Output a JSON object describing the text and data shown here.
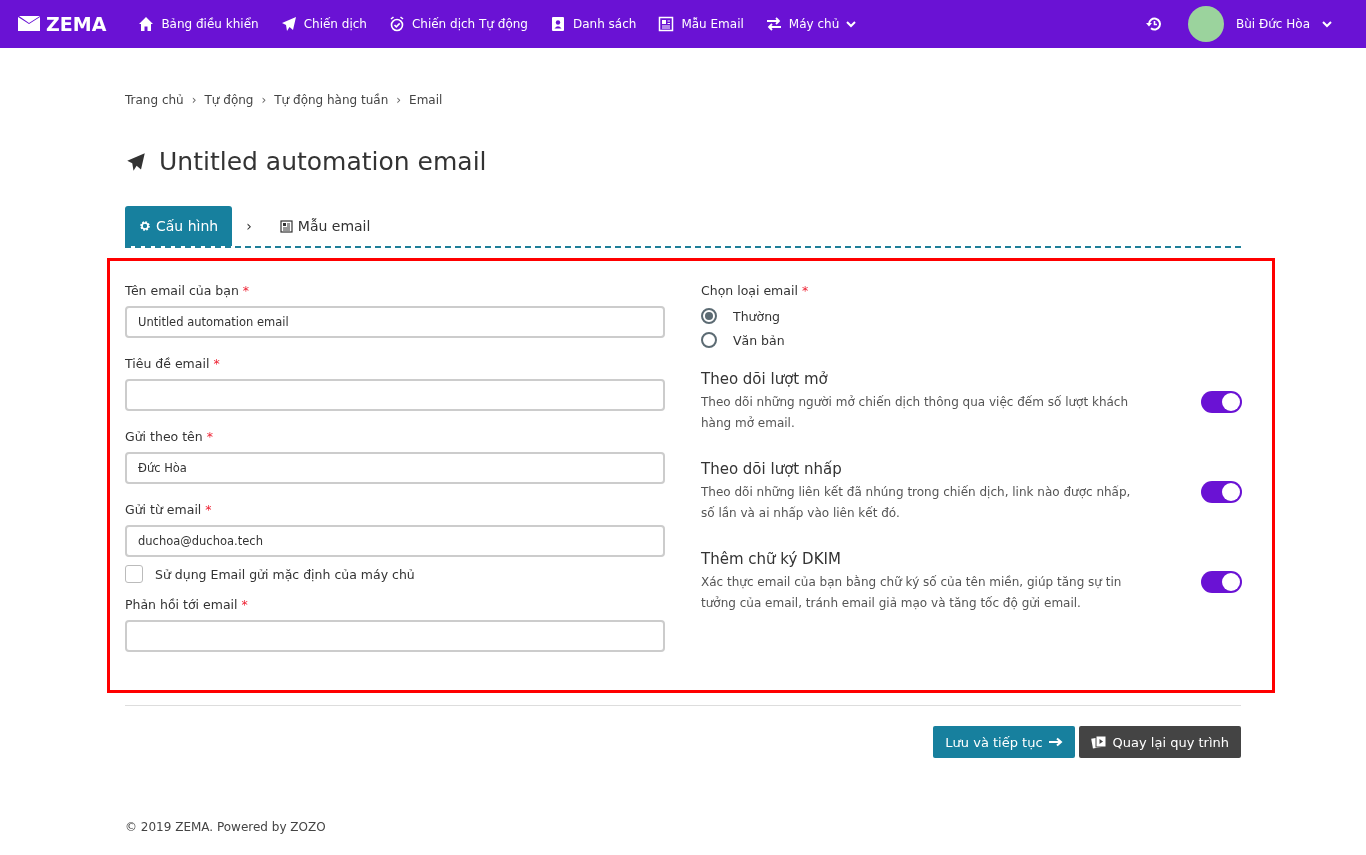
{
  "navbar": {
    "brand": "ZEMA",
    "items": [
      {
        "label": "Bảng điều khiển"
      },
      {
        "label": "Chiến dịch"
      },
      {
        "label": "Chiến dịch Tự động"
      },
      {
        "label": "Danh sách"
      },
      {
        "label": "Mẫu Email"
      },
      {
        "label": "Máy chủ",
        "dropdown": true
      }
    ],
    "user": {
      "name": "Bùi Đức Hòa"
    }
  },
  "breadcrumb": {
    "separator": "›",
    "items": [
      "Trang chủ",
      "Tự động",
      "Tự động hàng tuần",
      "Email"
    ]
  },
  "title": "Untitled automation email",
  "steps": {
    "separator": "›",
    "items": [
      {
        "label": "Cấu hình",
        "selected": true
      },
      {
        "label": "Mẫu email",
        "selected": false
      }
    ]
  },
  "form": {
    "fields": [
      {
        "label": "Tên email của bạn",
        "mark": "*",
        "value": "Untitled automation email"
      },
      {
        "label": "Tiêu đề email",
        "mark": "*"
      },
      {
        "label": "Gửi theo tên",
        "mark": "*",
        "value": "Đức Hòa"
      },
      {
        "label": "Gửi từ email",
        "mark": "*",
        "value": "duchoa@duchoa.tech",
        "option": {
          "label": "Sử dụng Email gửi mặc định của máy chủ",
          "checked": false
        }
      },
      {
        "label": "Phản hồi tới email",
        "mark": "*"
      }
    ],
    "email_type": {
      "label": "Chọn loại email",
      "mark": "*",
      "options": [
        {
          "label": "Thường",
          "selected": true
        },
        {
          "label": "Văn bản",
          "selected": false
        }
      ]
    },
    "toggles": [
      {
        "title": "Theo dõi lượt mở",
        "description": "Theo dõi những người mở chiến dịch thông qua việc đếm số lượt khách hàng mở email.",
        "on": true
      },
      {
        "title": "Theo dõi lượt nhấp",
        "description": "Theo dõi những liên kết đã nhúng trong chiến dịch, link nào được nhấp, số lần và ai nhấp vào liên kết đó.",
        "on": true
      },
      {
        "title": "Thêm chữ ký DKIM",
        "description": "Xác thực email của bạn bằng chữ ký số của tên miền, giúp tăng sự tin tưởng của email, tránh email giả mạo và tăng tốc độ gửi email.",
        "on": true
      }
    ]
  },
  "buttons": [
    {
      "label": "Lưu và tiếp tục",
      "kind": "primary"
    },
    {
      "label": "Quay lại quy trình",
      "kind": "secondary"
    }
  ],
  "footer": "© 2019 ZEMA. Powered by ZOZO"
}
